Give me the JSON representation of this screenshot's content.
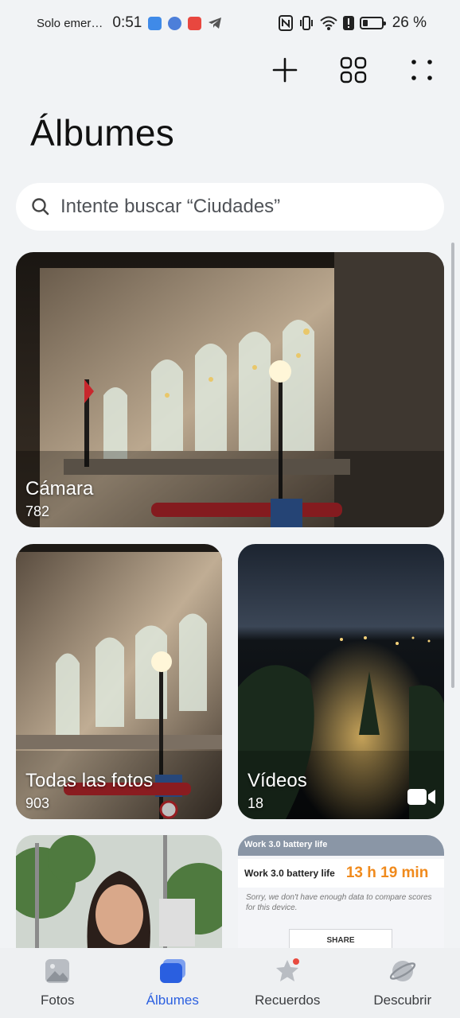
{
  "status_bar": {
    "carrier": "Solo emer…",
    "time": "0:51",
    "battery_percent": "26 %",
    "battery_level": 0.26
  },
  "header": {
    "title": "Álbumes",
    "actions": [
      {
        "name": "add-icon"
      },
      {
        "name": "grid-view-icon"
      },
      {
        "name": "more-options-icon"
      }
    ]
  },
  "search": {
    "placeholder": "Intente buscar “Ciudades”"
  },
  "albums": [
    {
      "name": "Cámara",
      "count": "782"
    },
    {
      "name": "Todas las fotos",
      "count": "903"
    },
    {
      "name": "Vídeos",
      "count": "18",
      "icon": "video-camera-icon"
    }
  ],
  "battery_screenshot": {
    "header": "Work 3.0 battery life",
    "title": "Work 3.0 battery life",
    "value": "13 h 19 min",
    "note": "Sorry, we don't have enough data to compare scores for this device.",
    "share": "SHARE"
  },
  "bottom_nav": {
    "items": [
      {
        "label": "Fotos",
        "icon": "photos-icon"
      },
      {
        "label": "Álbumes",
        "icon": "albums-icon",
        "active": true
      },
      {
        "label": "Recuerdos",
        "icon": "memories-star-icon"
      },
      {
        "label": "Descubrir",
        "icon": "discover-planet-icon"
      }
    ]
  },
  "colors": {
    "accent": "#2a5fe0",
    "background": "#f1f3f5",
    "highlight": "#f08a1c"
  }
}
